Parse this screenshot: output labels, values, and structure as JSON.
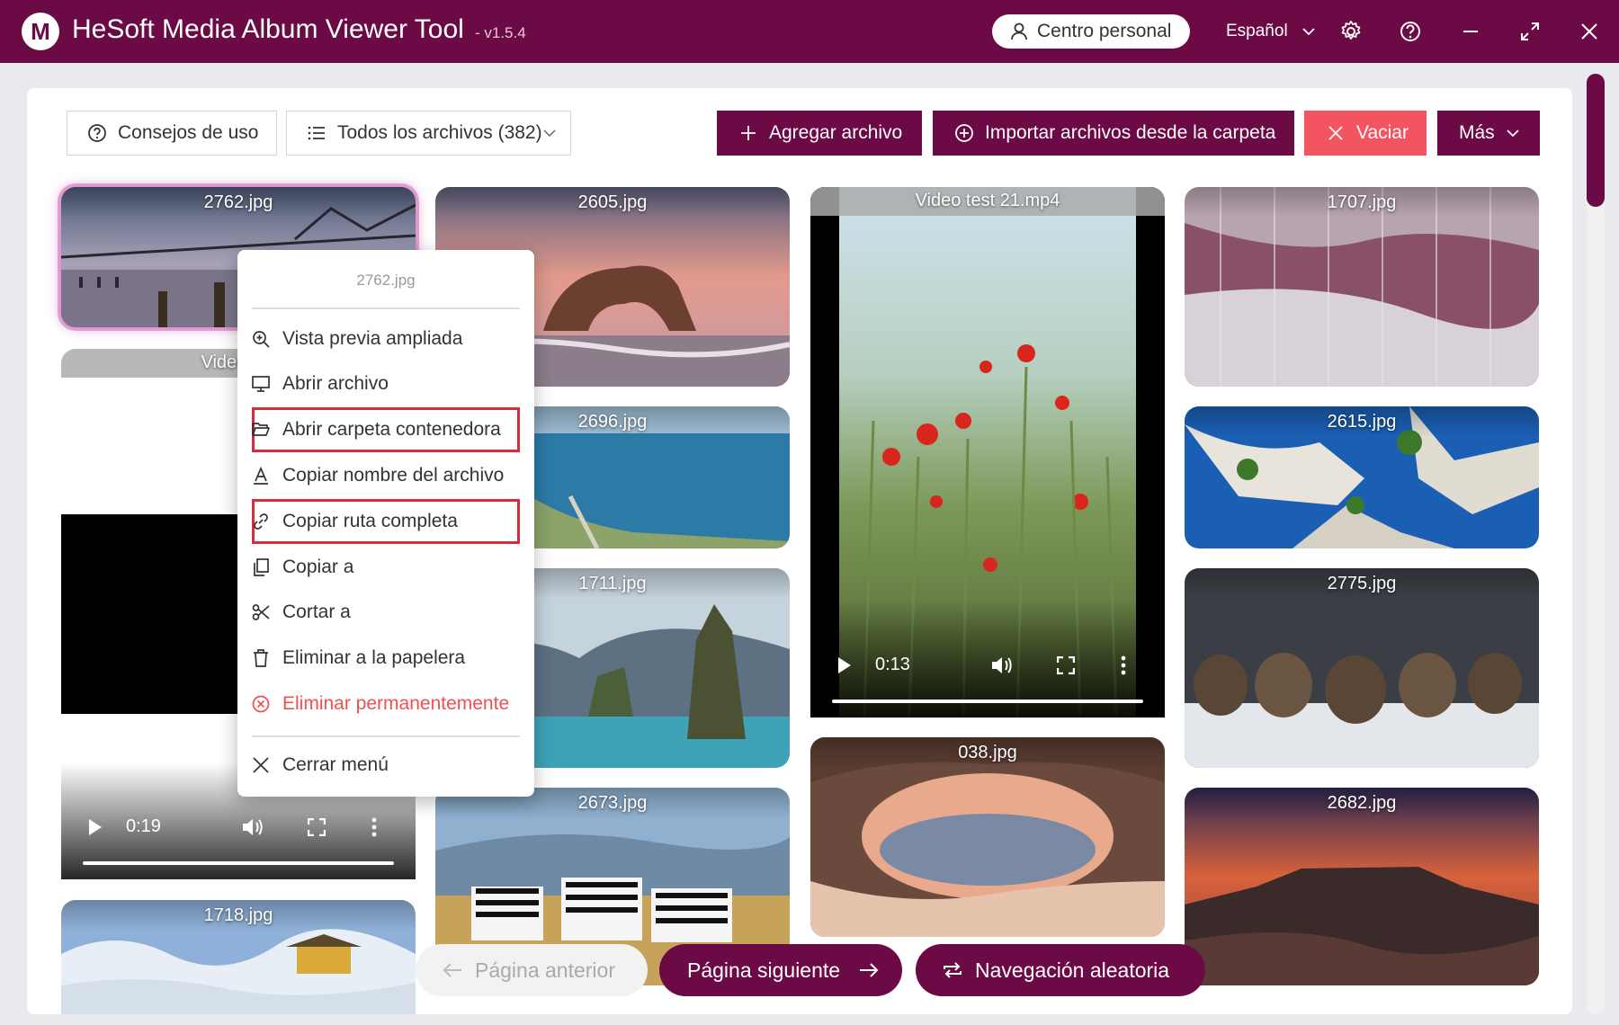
{
  "app": {
    "logo_letter": "M",
    "title": "HeSoft Media Album Viewer Tool",
    "version": "- v1.5.4"
  },
  "header": {
    "personal_center": "Centro personal",
    "language": "Español"
  },
  "toolbar": {
    "tips": "Consejos de uso",
    "filter": "Todos los archivos (382)",
    "add_file": "Agregar archivo",
    "import_folder": "Importar archivos desde la carpeta",
    "clear": "Vaciar",
    "more": "Más"
  },
  "tiles": [
    {
      "name": "2762.jpg"
    },
    {
      "name": "Video tes"
    },
    {
      "name": "1718.jpg"
    },
    {
      "name": "2605.jpg"
    },
    {
      "name": "2696.jpg"
    },
    {
      "name": "1711.jpg"
    },
    {
      "name": "2673.jpg"
    },
    {
      "name": "Video test 21.mp4"
    },
    {
      "name": "038.jpg"
    },
    {
      "name": "1707.jpg"
    },
    {
      "name": "2615.jpg"
    },
    {
      "name": "2775.jpg"
    },
    {
      "name": "2682.jpg"
    }
  ],
  "videos": {
    "left_time": "0:19",
    "center_time": "0:13",
    "left_progress": 0,
    "center_progress": 0
  },
  "context_menu": {
    "header": "2762.jpg",
    "items": [
      {
        "label": "Vista previa ampliada"
      },
      {
        "label": "Abrir archivo"
      },
      {
        "label": "Abrir carpeta contenedora"
      },
      {
        "label": "Copiar nombre del archivo"
      },
      {
        "label": "Copiar ruta completa"
      },
      {
        "label": "Copiar a"
      },
      {
        "label": "Cortar a"
      },
      {
        "label": "Eliminar a la papelera"
      },
      {
        "label": "Eliminar permanentemente"
      },
      {
        "label": "Cerrar menú"
      }
    ]
  },
  "pagination": {
    "prev": "Página anterior",
    "next": "Página siguiente",
    "random": "Navegación aleatoria"
  },
  "colors": {
    "brand": "#6b0a45",
    "danger": "#f25560",
    "highlight_box": "#d62b3a"
  }
}
